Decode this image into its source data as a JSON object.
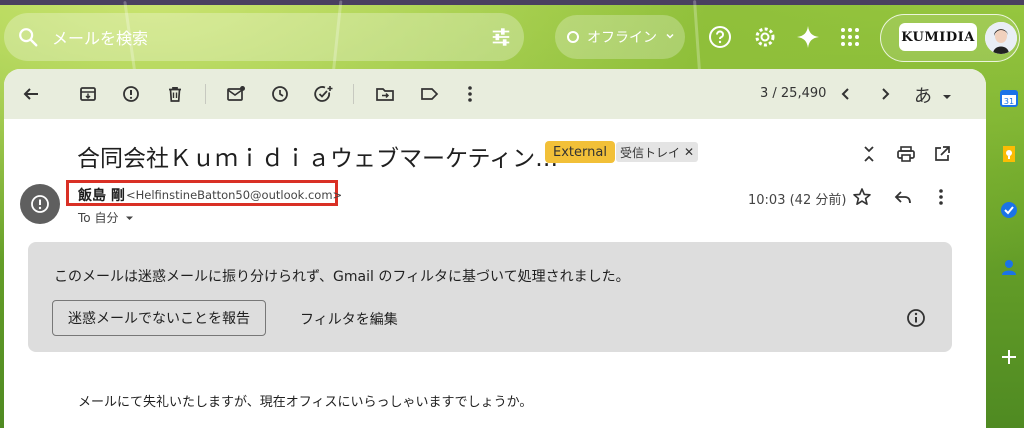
{
  "search": {
    "placeholder": "メールを検索"
  },
  "status": {
    "label": "オフライン"
  },
  "account": {
    "logo_text": "KUMIDIA"
  },
  "toolbar": {
    "counter": "3 / 25,490",
    "input_tool": "あ"
  },
  "email": {
    "subject": "合同会社Ｋｕｍｉｄｉａウェブマーケティン…",
    "badge_external": "External",
    "badge_label": "受信トレイ",
    "sender_name": "飯島 剛",
    "sender_email": "<HelfinstineBatton50@outlook.com>",
    "to": "To 自分",
    "time": "10:03 (42 分前)",
    "body": "メールにて失礼いたしますが、現在オフィスにいらっしゃいますでしょうか。"
  },
  "spam_notice": {
    "message": "このメールは迷惑メールに振り分けられず、Gmail のフィルタに基づいて処理されました。",
    "report_button": "迷惑メールでないことを報告",
    "edit_filter": "フィルタを編集"
  },
  "colors": {
    "external_badge": "#f2c038",
    "highlight_border": "#d93025",
    "calendar": "#1a73e8",
    "keep": "#fbbc04",
    "contacts": "#1a73e8"
  }
}
